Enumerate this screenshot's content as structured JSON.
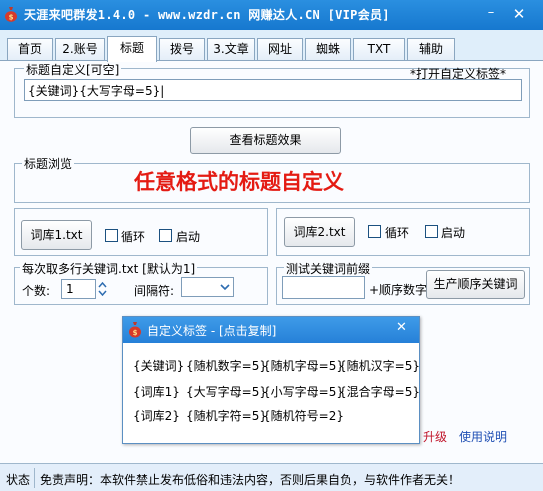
{
  "window": {
    "title": "天涯来吧群发1.4.0 - www.wzdr.cn 网赚达人.CN [VIP会员]",
    "minimize_glyph": "–",
    "close_glyph": "✕",
    "app_icon": "money-bag-icon"
  },
  "tabs": [
    {
      "label": "首页"
    },
    {
      "label": "2.账号"
    },
    {
      "label": "标题"
    },
    {
      "label": "拨号"
    },
    {
      "label": "3.文章"
    },
    {
      "label": "网址"
    },
    {
      "label": "蜘蛛"
    },
    {
      "label": "TXT"
    },
    {
      "label": "辅助"
    }
  ],
  "active_tab": "标题",
  "custom_title": {
    "legend": "标题自定义[可空]",
    "open_tag_link": "*打开自定义标签*",
    "value": "{关键词}{大写字母=5}|"
  },
  "preview_button": "查看标题效果",
  "preview": {
    "legend": "标题浏览",
    "text": "任意格式的标题自定义",
    "color": "#e41b13"
  },
  "lib1": {
    "button": "词库1.txt",
    "loop_label": "循环",
    "start_label": "启动"
  },
  "lib2": {
    "button": "词库2.txt",
    "loop_label": "循环",
    "start_label": "启动"
  },
  "multi_keyword": {
    "legend": "每次取多行关键词.txt [默认为1]",
    "count_label": "个数:",
    "count_value": "1",
    "separator_label": "间隔符:",
    "separator_value": ""
  },
  "prefix_test": {
    "legend": "测试关键词前缀",
    "input_value": "",
    "order_digit_label": "+顺序数字",
    "generate_button": "生产顺序关键词"
  },
  "links": {
    "upgrade": "升级",
    "help": "使用说明"
  },
  "popup": {
    "title": "自定义标签 - [点击复制]",
    "close_glyph": "✕",
    "tags": [
      [
        "{关键词}",
        "{随机数字=5}",
        "{随机字母=5}",
        "{随机汉字=5}"
      ],
      [
        "{词库1}",
        "{大写字母=5}",
        "{小写字母=5}",
        "{混合字母=5}"
      ],
      [
        "{词库2}",
        "{随机字符=5}",
        "{随机符号=2}"
      ]
    ]
  },
  "status": {
    "label": "状态",
    "disclaimer": "免责声明：本软件禁止发布低俗和违法内容，否则后果自负，与软件作者无关！"
  }
}
